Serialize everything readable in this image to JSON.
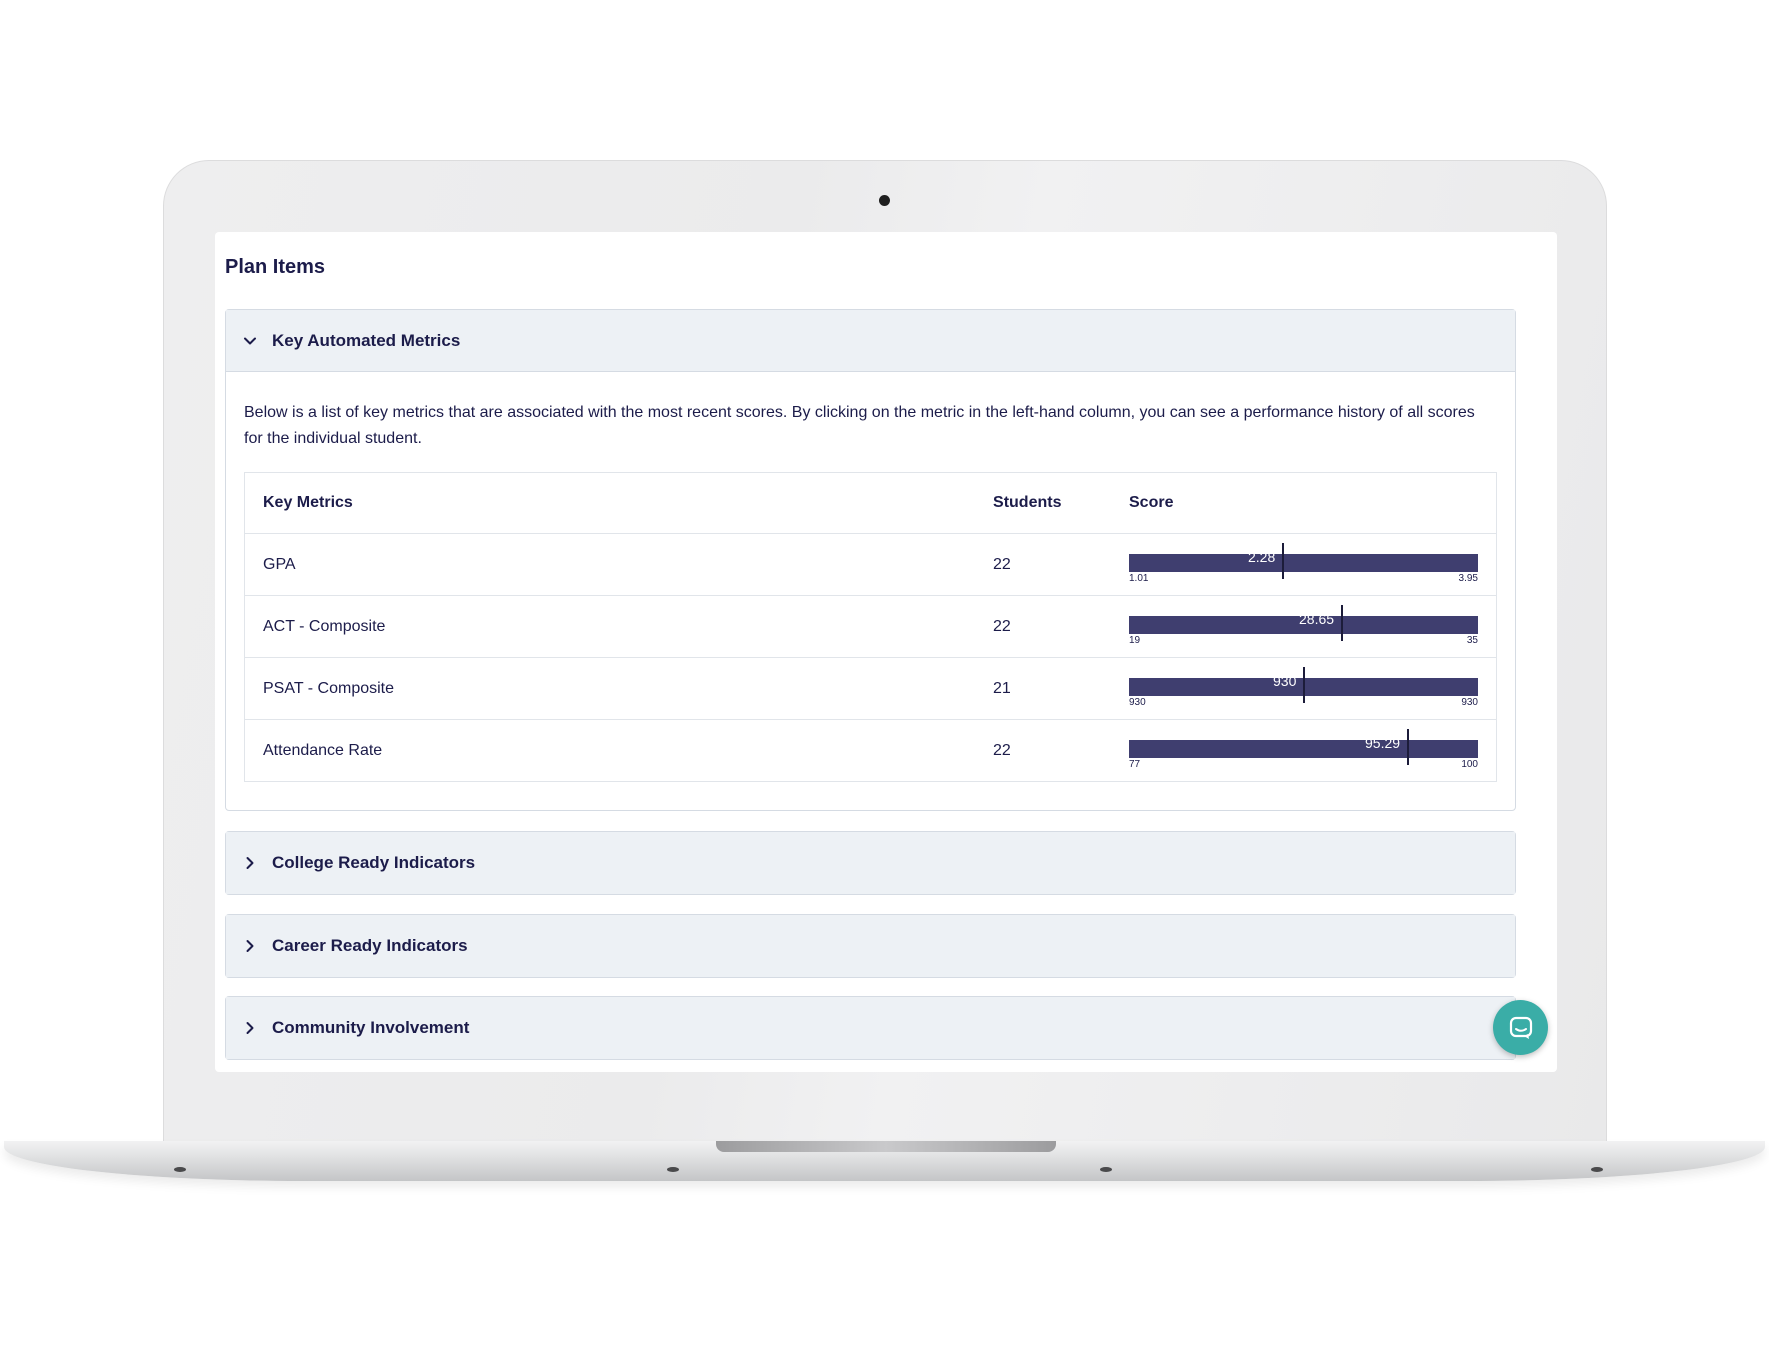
{
  "page": {
    "title": "Plan Items"
  },
  "sections": [
    {
      "title": "Key Automated Metrics",
      "expanded": true,
      "description": "Below is a list of key metrics that are associated with the most recent scores. By clicking on the metric in the left-hand column, you can see a performance history of all scores for the individual student.",
      "table": {
        "headers": {
          "metric": "Key Metrics",
          "students": "Students",
          "score": "Score"
        },
        "rows": [
          {
            "metric": "GPA",
            "students": "22",
            "score": "2.28",
            "min": "1.01",
            "max": "3.95",
            "marker_fraction": 0.44
          },
          {
            "metric": "ACT - Composite",
            "students": "22",
            "score": "28.65",
            "min": "19",
            "max": "35",
            "marker_fraction": 0.61
          },
          {
            "metric": "PSAT - Composite",
            "students": "21",
            "score": "930",
            "min": "930",
            "max": "930",
            "marker_fraction": 0.5
          },
          {
            "metric": "Attendance Rate",
            "students": "22",
            "score": "95.29",
            "min": "77",
            "max": "100",
            "marker_fraction": 0.8
          }
        ]
      }
    },
    {
      "title": "College Ready Indicators",
      "expanded": false
    },
    {
      "title": "Career Ready Indicators",
      "expanded": false
    },
    {
      "title": "Community Involvement",
      "expanded": false
    }
  ],
  "icons": {
    "expanded": "chevron-down-icon",
    "collapsed": "chevron-right-icon",
    "chat": "chat-icon"
  },
  "colors": {
    "bar": "#3f3e6f",
    "header_bg": "#edf1f5",
    "text": "#1c1c4a",
    "chat": "#3aada7"
  }
}
